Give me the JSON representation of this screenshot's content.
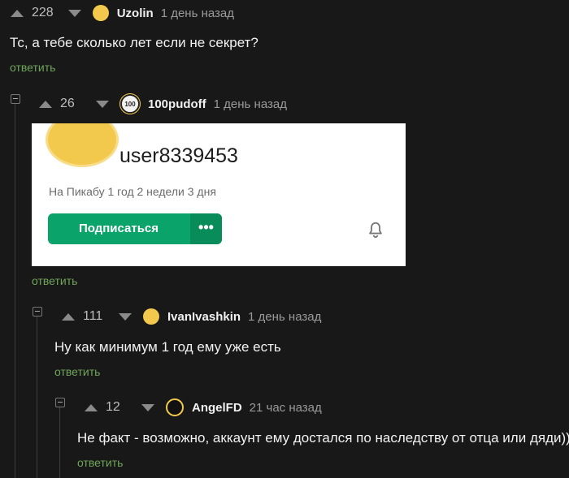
{
  "comments": [
    {
      "score": "228",
      "author": "Uzolin",
      "time": "1 день назад",
      "text": "Тс, а тебе сколько лет если не секрет?",
      "reply": "ответить"
    },
    {
      "score": "26",
      "author": "100pudoff",
      "time": "1 день назад",
      "avatar_badge": "100",
      "reply": "ответить",
      "embedded_card": {
        "username": "user8339453",
        "since": "На Пикабу 1 год 2 недели 3 дня",
        "subscribe": "Подписаться",
        "more": "•••"
      }
    },
    {
      "score": "111",
      "author": "IvanIvashkin",
      "time": "1 день назад",
      "text": "Ну как минимум 1 год ему уже есть",
      "reply": "ответить"
    },
    {
      "score": "12",
      "author": "AngelFD",
      "time": "21 час назад",
      "text": "Не факт - возможно, аккаунт ему достался по наследству от отца или дяди))",
      "reply": "ответить"
    }
  ],
  "colors": {
    "background": "#181818",
    "reply_link": "#6fa55a",
    "subscribe_button": "#0aa36a"
  }
}
